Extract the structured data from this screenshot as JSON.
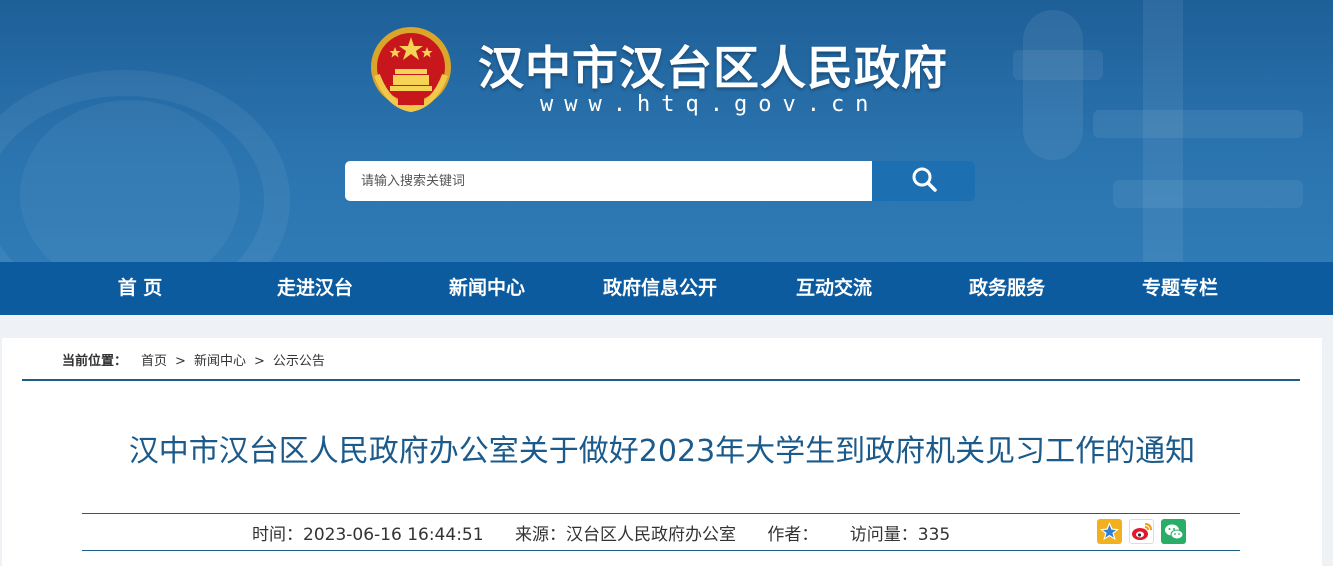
{
  "header": {
    "site_title": "汉中市汉台区人民政府",
    "site_url": "www.htq.gov.cn"
  },
  "search": {
    "placeholder": "请输入搜索关键词",
    "button_icon": "search-icon"
  },
  "nav": {
    "items": [
      {
        "label": "首 页"
      },
      {
        "label": "走进汉台"
      },
      {
        "label": "新闻中心"
      },
      {
        "label": "政府信息公开"
      },
      {
        "label": "互动交流"
      },
      {
        "label": "政务服务"
      },
      {
        "label": "专题专栏"
      }
    ]
  },
  "breadcrumb": {
    "label": "当前位置：",
    "items": [
      "首页",
      "新闻中心",
      "公示公告"
    ],
    "separator": ">"
  },
  "article": {
    "title": "汉中市汉台区人民政府办公室关于做好2023年大学生到政府机关见习工作的通知",
    "time": "时间：2023-06-16 16:44:51",
    "source": "来源：汉台区人民政府办公室",
    "author": "作者：",
    "visits": "访问量：335"
  },
  "share": {
    "icons": [
      "qzone-icon",
      "weibo-icon",
      "wechat-icon"
    ]
  },
  "colors": {
    "header_bg": "#2a73ae",
    "nav_bg": "#0c5b9f",
    "title_color": "#1b5a8a",
    "search_btn": "#1c6fb1"
  }
}
